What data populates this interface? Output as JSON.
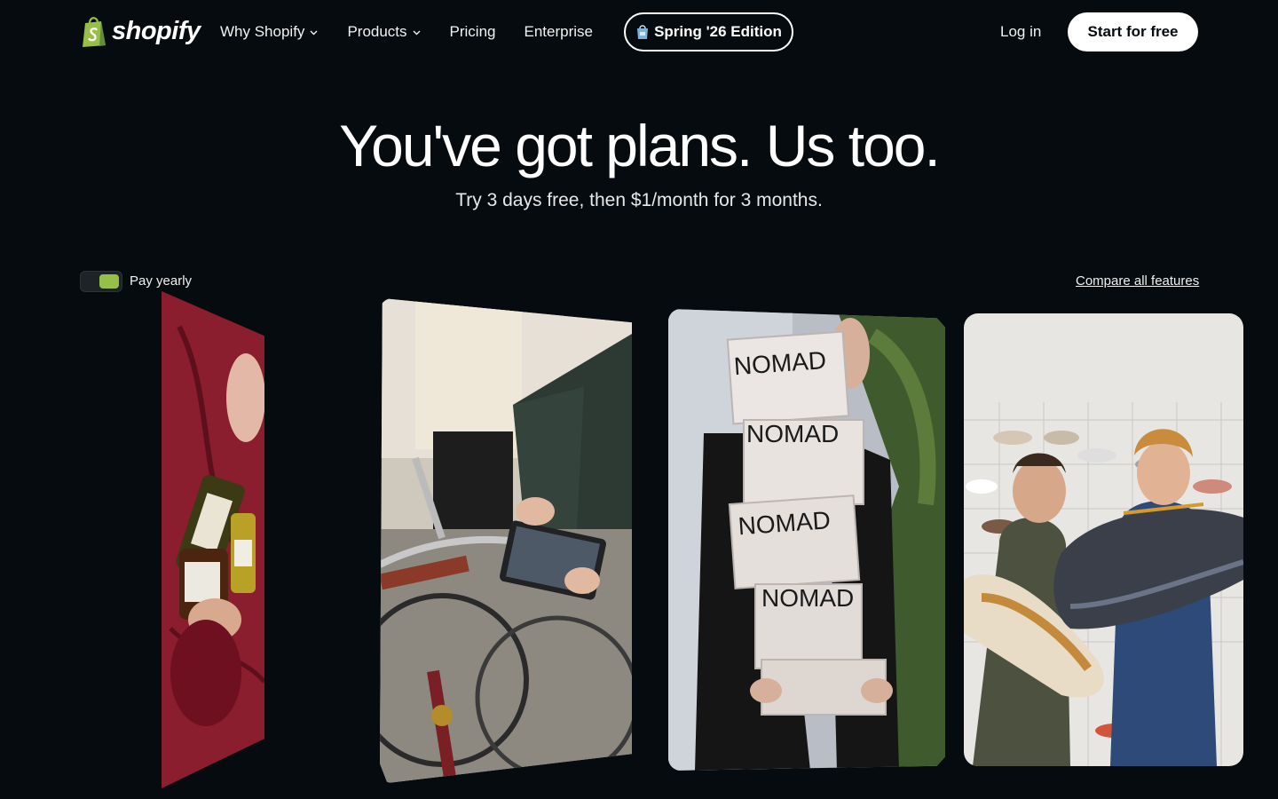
{
  "brand": {
    "name": "shopify",
    "accent_color": "#95bf47",
    "background_color": "#050b0e"
  },
  "nav": {
    "items": [
      {
        "label": "Why Shopify",
        "has_dropdown": true
      },
      {
        "label": "Products",
        "has_dropdown": true
      },
      {
        "label": "Pricing",
        "has_dropdown": false
      },
      {
        "label": "Enterprise",
        "has_dropdown": false
      }
    ],
    "edition_label": "Spring '26 Edition",
    "edition_icon": "shopping-bag-icon",
    "login_label": "Log in",
    "start_label": "Start for free"
  },
  "hero": {
    "title": "You've got plans. Us too.",
    "subtitle": "Try 3 days free, then $1/month for 3 months."
  },
  "billing": {
    "toggle_label": "Pay yearly",
    "toggle_on": true,
    "compare_label": "Compare all features"
  },
  "cards": {
    "box_label": "NOMAD"
  }
}
